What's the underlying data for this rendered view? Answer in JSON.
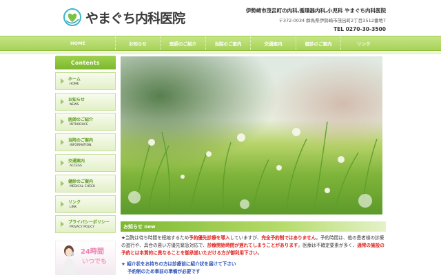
{
  "header": {
    "logo_text": "やまぐち内科医院",
    "tagline": "伊勢崎市茂呂町の内科,循環器内科,小児科 やまぐち内科医院",
    "address": "〒372-0034 群馬県伊勢崎市茂呂町2丁目3512番地7",
    "tel": "TEL 0270-30-3500"
  },
  "nav": {
    "items": [
      "HOME",
      "お知らせ",
      "医師のご紹介",
      "当院のご案内",
      "交通案内",
      "健診のご案内",
      "リンク"
    ]
  },
  "sidebar": {
    "title": "Contents",
    "items": [
      {
        "ja": "ホーム",
        "en": "HOME"
      },
      {
        "ja": "お知らせ",
        "en": "NEWS"
      },
      {
        "ja": "医師のご紹介",
        "en": "INTRODUCE"
      },
      {
        "ja": "当院のご案内",
        "en": "INFORMATION"
      },
      {
        "ja": "交通案内",
        "en": "ACCESS"
      },
      {
        "ja": "健診のご案内",
        "en": "MEDICAL CHECK"
      },
      {
        "ja": "リンク",
        "en": "LINK"
      },
      {
        "ja": "プライバシーポリシー",
        "en": "PRIVACY POLICY"
      }
    ],
    "banner": {
      "line1": "24時間",
      "line2": "いつでも"
    }
  },
  "news": {
    "title": "お知らせ new",
    "p1_a": "★当院は待ち時間を短縮するため",
    "p1_b": "予約優先診療を導入",
    "p1_c": "していますが、",
    "p1_d": "完全予約制ではありません",
    "p1_e": "。予約時間は、他の患者様の診療の進行や、具合の悪い方優先緊急対応で、",
    "p1_f": "診療開始時間が遅れてしまうことがあります",
    "p1_g": "。医療は不確定要素が多く、",
    "p1_h": "通常の施設の予約とは本質的に異なることを御承諾いただける方が御利用下さい",
    "p1_i": "。",
    "p2": "★ 紹介状をお持ちの方は診療前に紹介状を届けて下さい",
    "p3": "予約制のため事前の準備が必要です"
  }
}
